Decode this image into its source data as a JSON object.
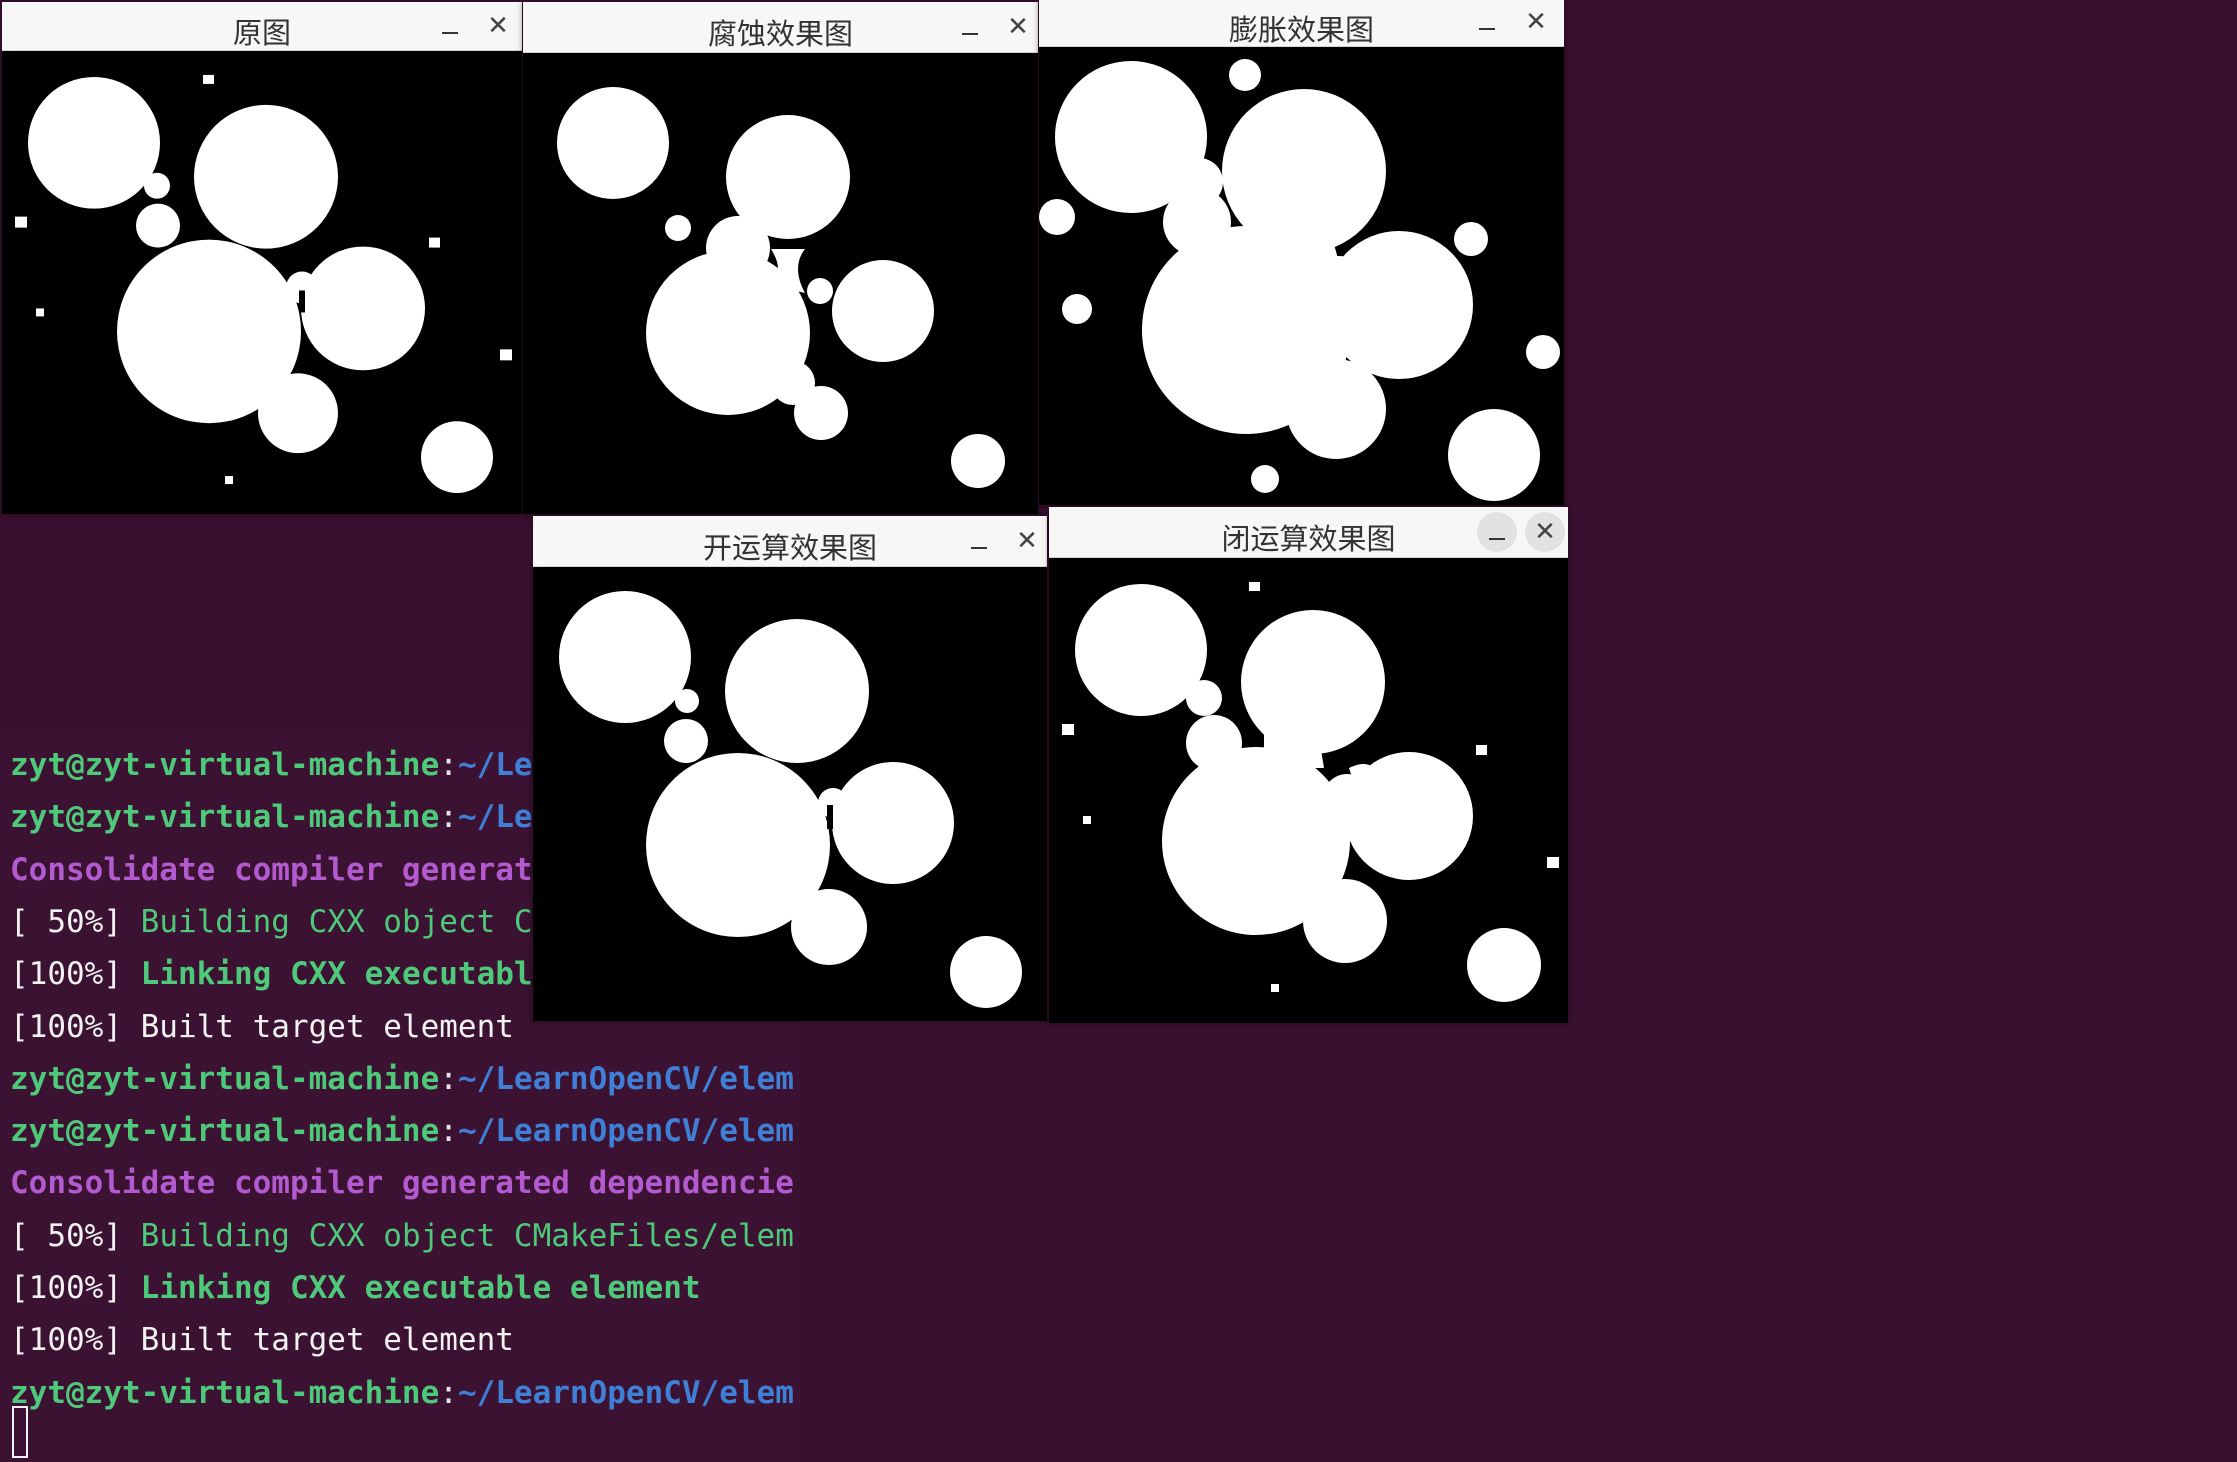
{
  "windows": {
    "original": {
      "title": "原图"
    },
    "erosion": {
      "title": "腐蚀效果图"
    },
    "dilation": {
      "title": "膨胀效果图"
    },
    "opening": {
      "title": "开运算效果图"
    },
    "closing": {
      "title": "闭运算效果图"
    }
  },
  "controls": {
    "minimize_symbol": "–",
    "close_symbol": "✕"
  },
  "terminal": {
    "prompt_user": "zyt@zyt-virtual-machine",
    "prompt_colon": ":",
    "prompt_path": "~/LearnOpenCV/elem",
    "lines": [
      {
        "type": "prompt"
      },
      {
        "type": "prompt"
      },
      {
        "type": "purple",
        "text": "Consolidate compiler generated dependencie"
      },
      {
        "type": "build",
        "prefix": "[ 50%] ",
        "text": "Building CXX object CMakeFiles/elem"
      },
      {
        "type": "link",
        "prefix": "[100%] ",
        "text": "Linking CXX executable element"
      },
      {
        "type": "plain",
        "text": "[100%] Built target element"
      },
      {
        "type": "prompt"
      },
      {
        "type": "prompt"
      },
      {
        "type": "purple",
        "text": "Consolidate compiler generated dependencie"
      },
      {
        "type": "build",
        "prefix": "[ 50%] ",
        "text": "Building CXX object CMakeFiles/elem"
      },
      {
        "type": "link",
        "prefix": "[100%] ",
        "text": "Linking CXX executable element"
      },
      {
        "type": "plain",
        "text": "[100%] Built target element"
      },
      {
        "type": "prompt"
      }
    ]
  },
  "colors": {
    "terminal_bg": "#3b1232",
    "prompt_green": "#4ec97a",
    "path_blue": "#3f7fd6",
    "purple": "#b45ad0"
  }
}
